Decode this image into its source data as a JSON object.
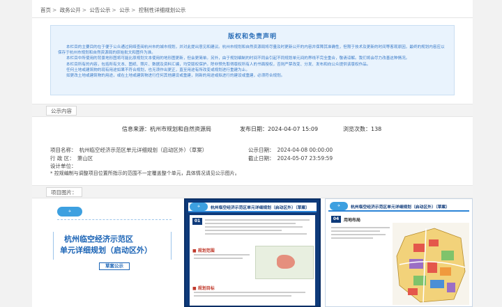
{
  "breadcrumb": [
    "首页",
    "政务公开",
    "公告公示",
    "公示",
    "控制性详细规划公示"
  ],
  "notice": {
    "title": "版权和免责声明",
    "paragraphs": [
      "本栏目的主要目的在于便于公众通过网络查阅杭州市的城市规划，并对此提出意见和建议。杭州市规划和自然资源局将尽量及时更新公开的内容并保障其准确性，但限于技术及更新的时间等客观原因，最终的规划内容应以保存于杭州市规划和自然资源局的原始批文和图件为准。",
      "本栏目中所使用的背景地形图将可能比原规划文本使用的地形图更新，但会更简单。另外，由于规划编制的时间不同会引起不同规划单元间的界线不完全重合，敬请谅解。我们将会尽力改善这种情况。",
      "本栏目所有的内容，包括所有文本、图纸、照片、数据及资料汇编，均受版权保护。除非预先取得版权所有人的书面授权，否则严禁改变、分发、发布和向公众提供该版权作品。",
      "任何土地或建筑物的现有用途如果不符合规划，也无须作出更正，直至用途有所改变或规划进行重建为止。",
      "如更改土地或建筑物的用途，或在土地或建筑物进行任何其他建设或重建，则新的用途或拟进行的建设或重建，必须符合规划。"
    ]
  },
  "section_content": "公示内容",
  "meta": {
    "source": "信息来源：杭州市规划和自然资源局",
    "publish_date": "发布日期：2024-04-07 15:09",
    "views": "浏览次数：138"
  },
  "fields": {
    "project_name_label": "项目名称：",
    "project_name": "杭州临空经济示范区单元详细规划（启动区外）（草案）",
    "district_label": "行 政 区：",
    "district": "萧山区",
    "design_unit_label": "设计单位：",
    "design_unit": "",
    "start_date_label": "公示日期：",
    "start_date": "2024-04-08 00:00:00",
    "end_date_label": "截止日期：",
    "end_date": "2024-05-07 23:59:59",
    "note": "* 控规编制与调整项目位置所指示的范围不一定覆盖整个单元，具体情况请见公示图片。"
  },
  "section_images": "项目图片：",
  "images": {
    "cover_title_line1": "杭州临空经济示范区",
    "cover_title_line2": "单元详细规划（启动区外）",
    "cover_badge": "草案公示",
    "panel_title": "杭州临空经济示范区单元详细规划（启动区外）（草案）",
    "panel2_section": "01",
    "panel2_sub1": "规划范围",
    "panel2_sub2": "规划目标",
    "panel3_section": "04",
    "panel3_sub": "用地布局"
  },
  "colors": {
    "notice_bg": "#e9f3fd",
    "notice_text": "#3a7bc8",
    "cover_title": "#1a63b5",
    "panel_bg": "#0e3a7a"
  }
}
